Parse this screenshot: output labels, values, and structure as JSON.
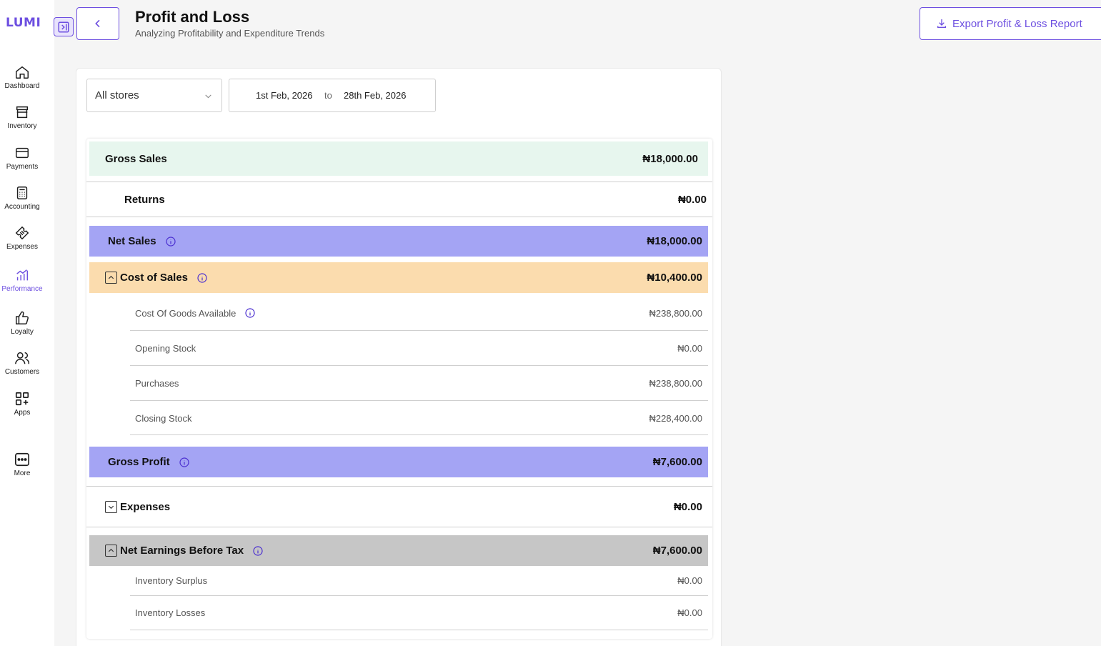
{
  "app": {
    "logo": "LUMI"
  },
  "sidebar": {
    "items": [
      {
        "label": "Dashboard",
        "icon": "home-icon"
      },
      {
        "label": "Inventory",
        "icon": "store-icon"
      },
      {
        "label": "Payments",
        "icon": "card-icon"
      },
      {
        "label": "Accounting",
        "icon": "calculator-icon"
      },
      {
        "label": "Expenses",
        "icon": "ticket-icon"
      },
      {
        "label": "Performance",
        "icon": "chart-icon",
        "active": true
      },
      {
        "label": "Loyalty",
        "icon": "thumbs-up-icon"
      },
      {
        "label": "Customers",
        "icon": "users-icon"
      },
      {
        "label": "Apps",
        "icon": "apps-icon"
      },
      {
        "label": "More",
        "icon": "more-icon"
      }
    ]
  },
  "header": {
    "title": "Profit and Loss",
    "subtitle": "Analyzing Profitability and Expenditure Trends",
    "export_label": "Export Profit & Loss Report"
  },
  "filters": {
    "store": "All stores",
    "date_from": "1st Feb, 2026",
    "date_sep": "to",
    "date_to": "28th Feb, 2026"
  },
  "report": {
    "gross_sales": {
      "label": "Gross Sales",
      "amount": "₦18,000.00"
    },
    "returns": {
      "label": "Returns",
      "amount": "₦0.00"
    },
    "net_sales": {
      "label": "Net Sales",
      "amount": "₦18,000.00"
    },
    "cost_of_sales": {
      "label": "Cost of Sales",
      "amount": "₦10,400.00"
    },
    "cost_items": [
      {
        "label": "Cost Of Goods Available",
        "amount": "₦238,800.00"
      },
      {
        "label": "Opening Stock",
        "amount": "₦0.00"
      },
      {
        "label": "Purchases",
        "amount": "₦238,800.00"
      },
      {
        "label": "Closing Stock",
        "amount": "₦228,400.00"
      }
    ],
    "gross_profit": {
      "label": "Gross Profit",
      "amount": "₦7,600.00"
    },
    "expenses": {
      "label": "Expenses",
      "amount": "₦0.00"
    },
    "net_earnings": {
      "label": "Net Earnings Before Tax",
      "amount": "₦7,600.00"
    },
    "earnings_items": [
      {
        "label": "Inventory Surplus",
        "amount": "₦0.00"
      },
      {
        "label": "Inventory Losses",
        "amount": "₦0.00"
      }
    ]
  },
  "colors": {
    "accent": "#6d4fe0",
    "gross_sales_bg": "#e7f6ee",
    "net_sales_bg": "#a4a4f4",
    "cost_of_sales_bg": "#fbdcae",
    "net_earnings_bg": "#c6c6c6"
  }
}
